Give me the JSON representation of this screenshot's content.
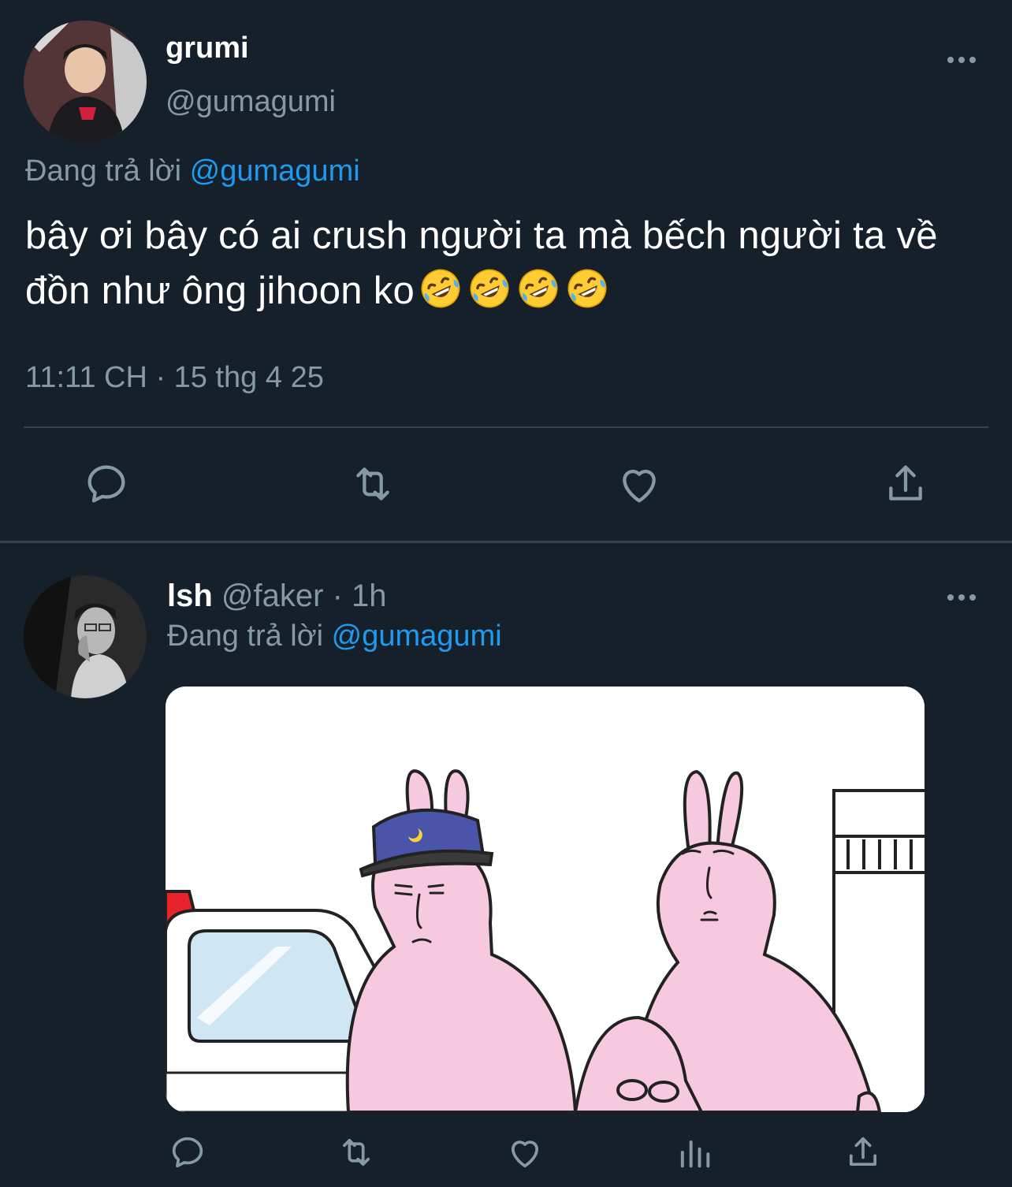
{
  "main_tweet": {
    "display_name": "grumi",
    "handle": "@gumagumi",
    "reply_prefix": "Đang trả lời",
    "reply_to": "@gumagumi",
    "text": "bây ơi bây có ai crush người ta mà bếch người ta về đồn như ông jihoon ko",
    "emoji_count": 4,
    "timestamp": "11:11 CH · 15 thg 4 25",
    "actions": [
      "reply-icon",
      "retweet-icon",
      "like-icon",
      "share-icon"
    ]
  },
  "reply_tweet": {
    "display_name": "lsh",
    "handle": "@faker",
    "separator": "·",
    "age": "1h",
    "reply_prefix": "Đang trả lời",
    "reply_to": "@gumagumi",
    "media": "cartoon: police rabbit arresting handcuffed rabbit",
    "actions": [
      "reply-icon",
      "retweet-icon",
      "like-icon",
      "views-icon",
      "share-icon"
    ]
  },
  "colors": {
    "background": "#15202b",
    "muted": "#8899a6",
    "link": "#1d9bf0",
    "divider": "#38444d"
  }
}
